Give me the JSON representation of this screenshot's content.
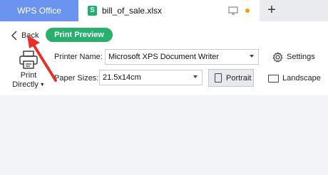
{
  "tabs": {
    "app_tab": "WPS Office",
    "file_tab": "bill_of_sale.xlsx",
    "file_tab_icon": "spreadsheet-icon",
    "file_tab_icon_letter": "S",
    "add_tab_symbol": "+"
  },
  "toolbar": {
    "back_label": "Back",
    "preview_label": "Print Preview",
    "print_directly_line1": "Print",
    "print_directly_line2": "Directly",
    "printer_name_label": "Printer Name:",
    "printer_name_value": "Microsoft XPS Document Writer",
    "settings_label": "Settings",
    "paper_sizes_label": "Paper Sizes:",
    "paper_size_value": "21.5x14cm",
    "portrait_label": "Portrait",
    "landscape_label": "Landscape",
    "selected_orientation": "Portrait"
  },
  "colors": {
    "app_tab_bg": "#6b93f0",
    "preview_pill_bg": "#29b06e",
    "sheet_icon": "#1fb06f",
    "unsaved_dot": "#f0a000",
    "annotation_arrow": "#e8302a"
  }
}
